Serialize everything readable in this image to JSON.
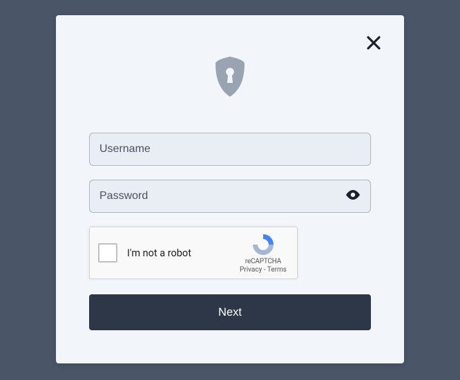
{
  "form": {
    "username_placeholder": "Username",
    "password_placeholder": "Password",
    "next_label": "Next"
  },
  "recaptcha": {
    "label": "I'm not a robot",
    "brand": "reCAPTCHA",
    "privacy": "Privacy",
    "separator": " - ",
    "terms": "Terms"
  },
  "icons": {
    "close": "close-icon",
    "shield_lock": "shield-lock-icon",
    "eye": "eye-icon",
    "recaptcha": "recaptcha-logo-icon"
  },
  "colors": {
    "page_bg": "#4a5568",
    "modal_bg": "#f2f5fa",
    "input_bg": "#e9edf4",
    "input_border": "#aeb6c2",
    "button_bg": "#2d3748",
    "button_text": "#ffffff",
    "shield": "#9aa3b2"
  }
}
